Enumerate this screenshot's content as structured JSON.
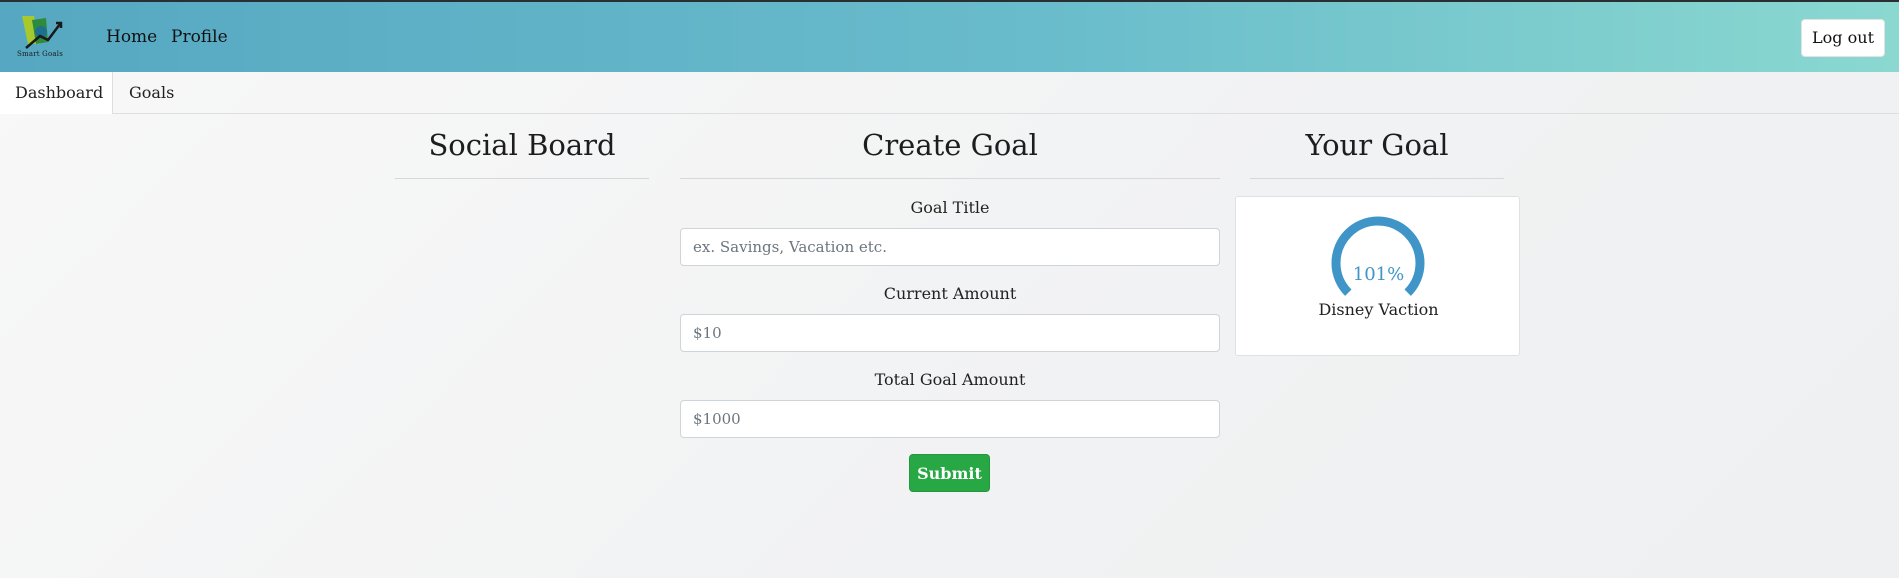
{
  "nav": {
    "logo_text": "Smart Goals",
    "home": "Home",
    "profile": "Profile",
    "logout": "Log out"
  },
  "tabs": [
    {
      "label": "Dashboard",
      "active": true
    },
    {
      "label": "Goals",
      "active": false
    }
  ],
  "social_board": {
    "title": "Social Board"
  },
  "create_goal": {
    "title": "Create Goal",
    "goal_title_label": "Goal Title",
    "goal_title_placeholder": "ex. Savings, Vacation etc.",
    "goal_title_value": "",
    "current_amount_label": "Current Amount",
    "current_amount_placeholder": "$10",
    "total_amount_label": "Total Goal Amount",
    "total_amount_placeholder": "$1000",
    "submit": "Submit"
  },
  "your_goal": {
    "title": "Your Goal",
    "percent_label": "101%",
    "progress_fraction": 1.01,
    "goal_name": "Disney Vaction"
  },
  "colors": {
    "accent": "#3f95c7",
    "submit_green": "#28a745",
    "nav_start": "#56a8c2",
    "nav_end": "#8ad8d0"
  }
}
